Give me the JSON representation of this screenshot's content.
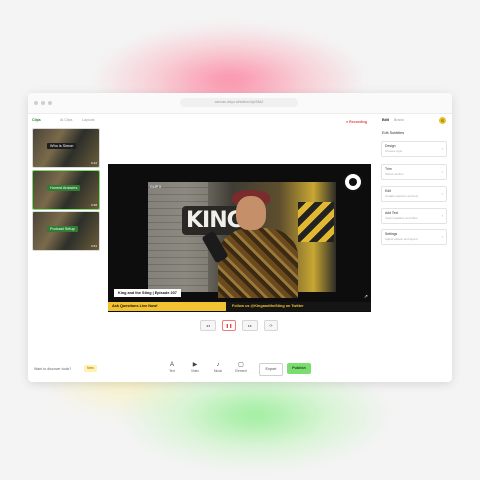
{
  "window": {
    "url": "canvas.vidyo.ai/editor/clip/28a2",
    "accent_color": "#7bdc6f",
    "record_color": "#e04848"
  },
  "sidebar": {
    "tab_active": "Clips",
    "tab_2": "AI Clips",
    "tab_3": "Layouts",
    "clips": [
      {
        "label": "Who is Simon",
        "color": "#1e1e1e",
        "duration": "0:42"
      },
      {
        "label": "Honest Answers",
        "color": "#2f7d32",
        "duration": "0:38"
      },
      {
        "label": "Podcast Setup",
        "color": "#2f7d32",
        "duration": "0:51"
      }
    ]
  },
  "header": {
    "record_label": "● Recording",
    "edit_tab": "Edit",
    "brand_tab": "Brand",
    "avatar_initial": "S"
  },
  "video": {
    "badge": "CLIP 3",
    "backdrop_text": "KING",
    "episode_title": "King and the Sting | Episode 207",
    "ticker_left": "Ask Questions Live Now!",
    "ticker_right": "Follow us @KingandtheSting on Twitter",
    "expand_icon": "↗"
  },
  "controls": {
    "prev": "◂◂",
    "play": "❚❚",
    "next": "▸▸",
    "loop": "⟳"
  },
  "panel": {
    "title": "Edit Subtitles",
    "fields": [
      {
        "label": "Design",
        "value": "Choose style"
      },
      {
        "label": "Trim",
        "value": "Select section"
      },
      {
        "label": "Edit",
        "value": "Update captions and text"
      },
      {
        "label": "Add Text",
        "value": "Insert headline and titles"
      },
      {
        "label": "Settings",
        "value": "Adjust aspect and layout"
      }
    ]
  },
  "footer": {
    "hint": "Want to discover tools?",
    "hint_badge": "New",
    "tools": [
      {
        "icon": "A",
        "label": "Text"
      },
      {
        "icon": "▶",
        "label": "Video"
      },
      {
        "icon": "♪",
        "label": "Music"
      },
      {
        "icon": "▢",
        "label": "Element"
      }
    ],
    "secondary_button": "Export",
    "primary_button": "Publish"
  }
}
